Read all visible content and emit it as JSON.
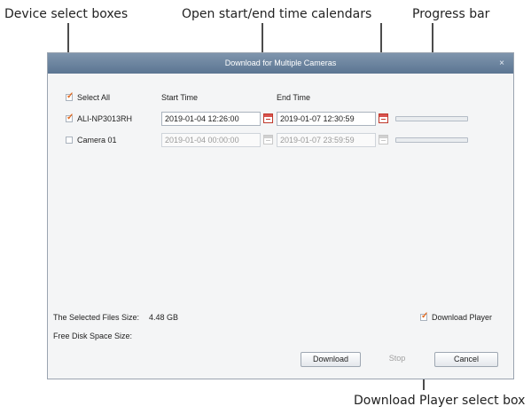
{
  "callouts": {
    "device_select": "Device select boxes",
    "calendars": "Open start/end time calendars",
    "progress": "Progress bar",
    "download_player": "Download Player select box"
  },
  "dialog": {
    "title": "Download for Multiple Cameras",
    "close": "×",
    "headers": {
      "select_all": "Select All",
      "start_time": "Start Time",
      "end_time": "End Time"
    },
    "rows": [
      {
        "device": "ALI-NP3013RH",
        "checked": true,
        "start": "2019-01-04 12:26:00",
        "end": "2019-01-07 12:30:59",
        "enabled": true,
        "progress": 0
      },
      {
        "device": "Camera 01",
        "checked": false,
        "start": "2019-01-04 00:00:00",
        "end": "2019-01-07 23:59:59",
        "enabled": false,
        "progress": 0
      }
    ],
    "selected_files_label": "The Selected Files Size:",
    "selected_files_value": "4.48 GB",
    "free_disk_label": "Free Disk Space Size:",
    "free_disk_value": "",
    "download_player_label": "Download Player",
    "download_player_checked": true,
    "buttons": {
      "download": "Download",
      "stop": "Stop",
      "cancel": "Cancel"
    }
  }
}
